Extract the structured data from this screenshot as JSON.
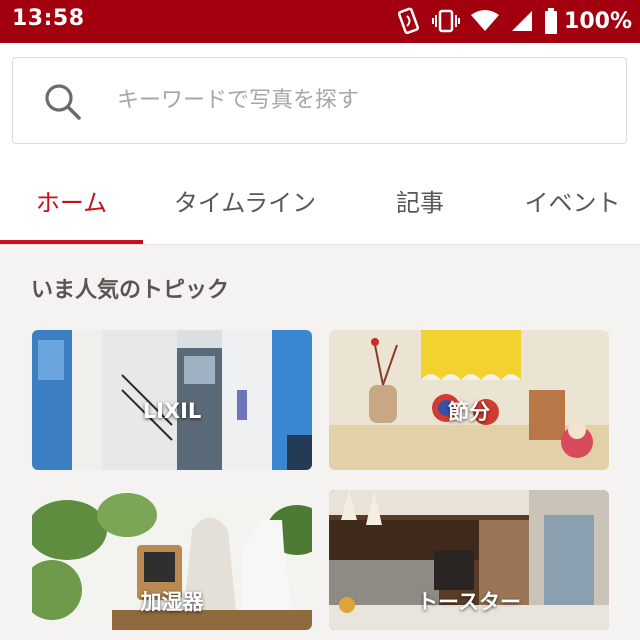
{
  "status_bar": {
    "time": "13:58",
    "battery": "100%",
    "icons": [
      "nfc-icon",
      "vibrate-icon",
      "wifi-icon",
      "signal-icon",
      "battery-icon"
    ]
  },
  "search": {
    "placeholder": "キーワードで写真を探す",
    "value": ""
  },
  "tabs": [
    {
      "label": "ホーム",
      "active": true
    },
    {
      "label": "タイムライン",
      "active": false
    },
    {
      "label": "記事",
      "active": false
    },
    {
      "label": "イベント",
      "active": false
    }
  ],
  "section": {
    "title": "いま人気のトピック"
  },
  "topics": [
    {
      "label": "LIXIL"
    },
    {
      "label": "節分"
    },
    {
      "label": "加湿器"
    },
    {
      "label": "トースター"
    }
  ],
  "colors": {
    "status_bar": "#a3000f",
    "accent": "#c5111c",
    "background": "#f4f3f1"
  }
}
